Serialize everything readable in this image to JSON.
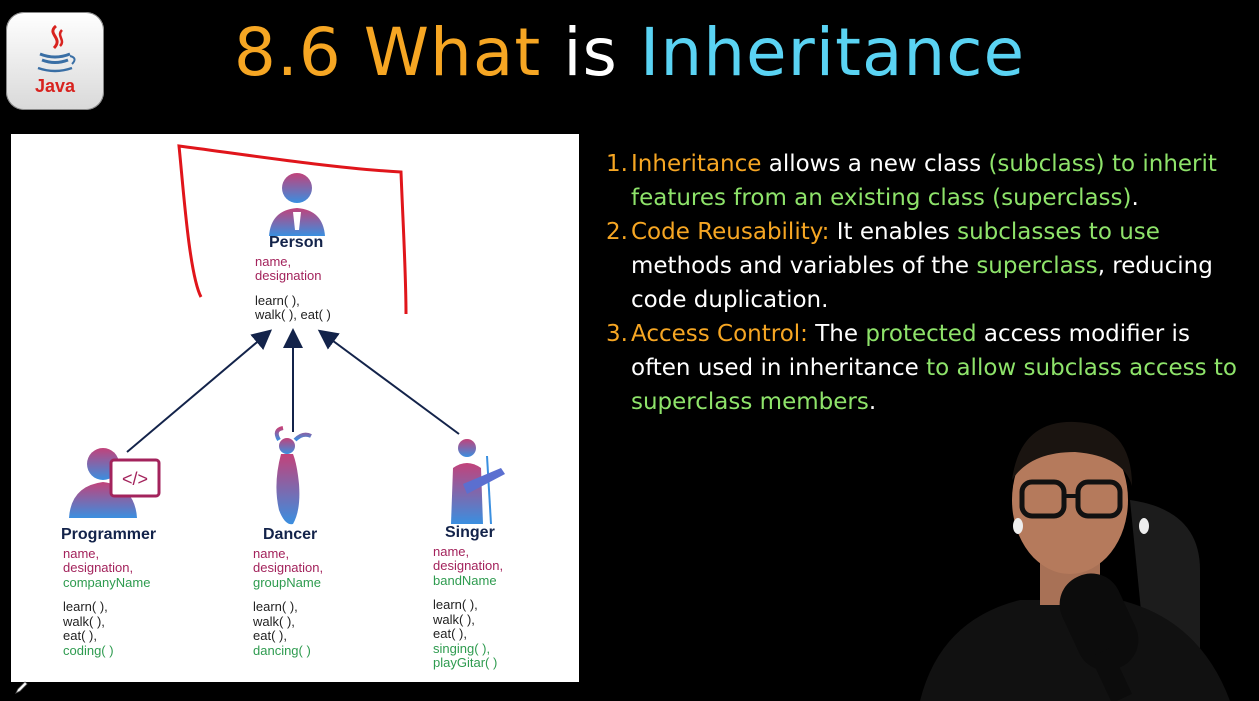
{
  "header": {
    "title_num": "8.6",
    "title_what": "What",
    "title_is": "is",
    "title_inheritance": "Inheritance"
  },
  "logo": {
    "label": "Java",
    "icon": "java-coffee-cup-icon"
  },
  "diagram": {
    "person": {
      "name": "Person",
      "fields": [
        "name,",
        "designation"
      ],
      "methods": [
        "learn( ),",
        "walk( ), eat( )"
      ]
    },
    "programmer": {
      "name": "Programmer",
      "fields": [
        "name,",
        "designation,"
      ],
      "extra_fields": [
        "companyName"
      ],
      "methods": [
        "learn( ),",
        "walk( ),",
        "eat( ),"
      ],
      "extra_methods": [
        "coding( )"
      ]
    },
    "dancer": {
      "name": "Dancer",
      "fields": [
        "name,",
        "designation,"
      ],
      "extra_fields": [
        "groupName"
      ],
      "methods": [
        "learn( ),",
        "walk( ),",
        "eat( ),"
      ],
      "extra_methods": [
        "dancing( )"
      ]
    },
    "singer": {
      "name": "Singer",
      "fields": [
        "name,",
        "designation,"
      ],
      "extra_fields": [
        "bandName"
      ],
      "methods": [
        "learn( ),",
        "walk( ),",
        "eat( ),"
      ],
      "extra_methods": [
        "singing( ),",
        "playGitar( )"
      ]
    },
    "code_glyph": "</>"
  },
  "points": [
    {
      "num": "1.",
      "parts": [
        {
          "t": "Inheritance",
          "c": "or"
        },
        {
          "t": " allows a new class ",
          "c": "wh"
        },
        {
          "t": "(subclass) to inherit features from an existing class (superclass)",
          "c": "gr"
        },
        {
          "t": ".",
          "c": "wh"
        }
      ]
    },
    {
      "num": "2.",
      "parts": [
        {
          "t": "Code Reusability:",
          "c": "or"
        },
        {
          "t": " It enables ",
          "c": "wh"
        },
        {
          "t": "subclasses to use",
          "c": "gr"
        },
        {
          "t": " methods and variables of the ",
          "c": "wh"
        },
        {
          "t": "superclass",
          "c": "gr"
        },
        {
          "t": ", reducing code duplication.",
          "c": "wh"
        }
      ]
    },
    {
      "num": "3.",
      "parts": [
        {
          "t": "Access Control:",
          "c": "or"
        },
        {
          "t": " The ",
          "c": "wh"
        },
        {
          "t": "protected",
          "c": "gr"
        },
        {
          "t": " access modifier is often used in inheritance ",
          "c": "wh"
        },
        {
          "t": "to allow subclass access to superclass members",
          "c": "gr"
        },
        {
          "t": ".",
          "c": "wh"
        }
      ]
    }
  ],
  "colors": {
    "orange": "#f6a623",
    "cyan": "#5ad3f3",
    "green": "#8ee36a",
    "annotation_red": "#e0151b",
    "field_red": "#a3235c",
    "field_green": "#2e9b4f"
  }
}
